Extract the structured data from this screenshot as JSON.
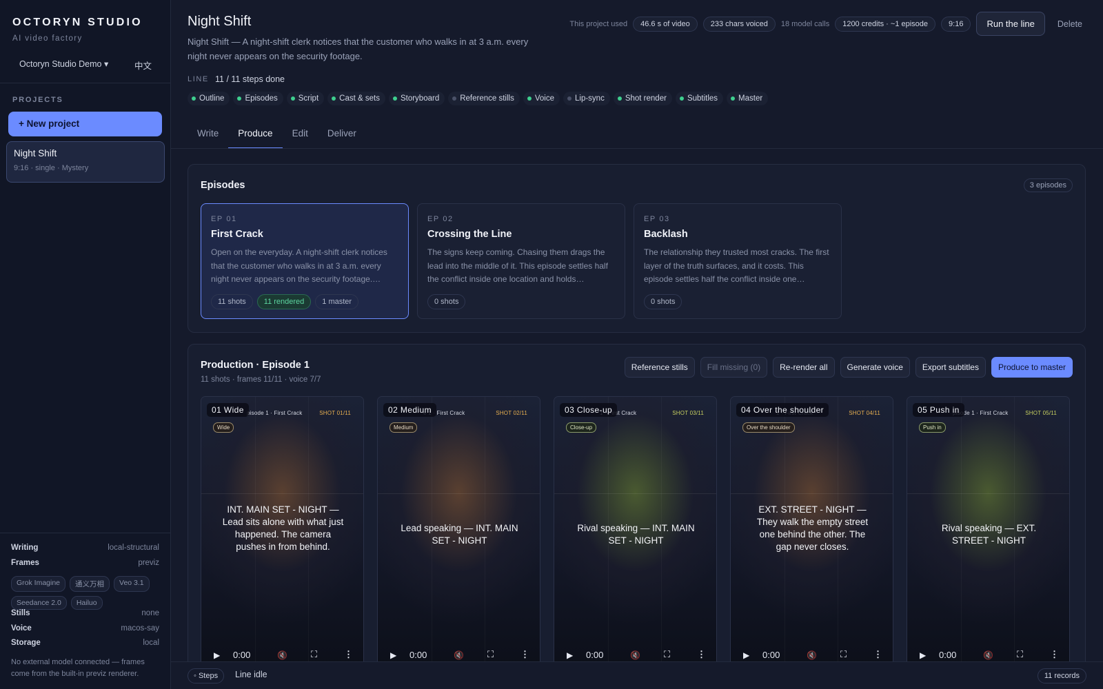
{
  "sidebar": {
    "brand": "OCTORYN STUDIO",
    "brand_sub": "AI video factory",
    "org": "Octoryn Studio Demo ▾",
    "lang": "中文",
    "projects_label": "PROJECTS",
    "new_project": "+ New project",
    "project": {
      "name": "Night Shift",
      "meta": "9:16 · single · Mystery"
    },
    "config": {
      "writing": {
        "label": "Writing",
        "value": "local-structural"
      },
      "frames": {
        "label": "Frames",
        "value": "previz"
      },
      "frame_models": [
        "Grok Imagine",
        "通义万相",
        "Veo 3.1",
        "Seedance 2.0",
        "Hailuo"
      ],
      "stills": {
        "label": "Stills",
        "value": "none"
      },
      "voice": {
        "label": "Voice",
        "value": "macos-say"
      },
      "storage": {
        "label": "Storage",
        "value": "local"
      }
    },
    "note": "No external model connected — frames come from the built-in previz renderer."
  },
  "header": {
    "title": "Night Shift",
    "logline": "Night Shift — A night-shift clerk notices that the customer who walks in at 3 a.m. every night never appears on the security footage.",
    "usage_label": "This project used",
    "video": "46.6 s of video",
    "chars": "233 chars voiced",
    "calls": "18 model calls",
    "credits": "1200 credits · ~1 episode",
    "ratio": "9:16",
    "run": "Run the line",
    "delete": "Delete",
    "line_label": "LINE",
    "line_status": "11 / 11 steps done",
    "steps": [
      {
        "label": "Outline",
        "done": true
      },
      {
        "label": "Episodes",
        "done": true
      },
      {
        "label": "Script",
        "done": true
      },
      {
        "label": "Cast & sets",
        "done": true
      },
      {
        "label": "Storyboard",
        "done": true
      },
      {
        "label": "Reference stills",
        "done": false
      },
      {
        "label": "Voice",
        "done": true
      },
      {
        "label": "Lip-sync",
        "done": false
      },
      {
        "label": "Shot render",
        "done": true
      },
      {
        "label": "Subtitles",
        "done": true
      },
      {
        "label": "Master",
        "done": true
      }
    ],
    "tabs": [
      "Write",
      "Produce",
      "Edit",
      "Deliver"
    ],
    "active_tab": "Produce"
  },
  "colors": {
    "accent": "#6b8bff",
    "done": "#3ecf8e",
    "pending": "#4a5168"
  },
  "episodes": {
    "title": "Episodes",
    "count": "3 episodes",
    "items": [
      {
        "num": "EP 01",
        "title": "First Crack",
        "desc": "Open on the everyday. A night-shift clerk notices that the customer who walks in at 3 a.m. every night never appears on the security footage.…",
        "chips": [
          "11 shots",
          "11 rendered",
          "1 master"
        ]
      },
      {
        "num": "EP 02",
        "title": "Crossing the Line",
        "desc": "The signs keep coming. Chasing them drags the lead into the middle of it. This episode settles half the conflict inside one location and holds…",
        "chips": [
          "0 shots"
        ]
      },
      {
        "num": "EP 03",
        "title": "Backlash",
        "desc": "The relationship they trusted most cracks. The first layer of the truth surfaces, and it costs. This episode settles half the conflict inside one…",
        "chips": [
          "0 shots"
        ]
      }
    ]
  },
  "production": {
    "title": "Production · Episode 1",
    "subtitle": "11 shots · frames 11/11 · voice 7/7",
    "actions": [
      "Reference stills",
      "Fill missing (0)",
      "Re-render all",
      "Generate voice",
      "Export subtitles",
      "Produce to master"
    ],
    "shots": [
      {
        "badge": "01 Wide",
        "caption": "pisode 1 · First Crack",
        "code": "SHOT 01/11",
        "type": "Wide",
        "text": "INT. MAIN SET - NIGHT — Lead sits alone with what just happened. The camera pushes in from behind.",
        "time": "0:00",
        "tint": "#5a4030",
        "codecolor": "#e8b050"
      },
      {
        "badge": "02 Medium",
        "caption": "e 1 · First Crack",
        "code": "SHOT 02/11",
        "type": "Medium",
        "text": "Lead speaking — INT. MAIN SET - NIGHT",
        "time": "0:00",
        "tint": "#5a4030",
        "codecolor": "#e8b050"
      },
      {
        "badge": "03 Close-up",
        "caption": "1 · First Crack",
        "code": "SHOT 03/11",
        "type": "Close-up",
        "text": "Rival speaking — INT. MAIN SET - NIGHT",
        "time": "0:00",
        "tint": "#4a5a30",
        "codecolor": "#c8d060"
      },
      {
        "badge": "04 Over the shoulder",
        "caption": "1 · First Crack",
        "code": "SHOT 04/11",
        "type": "Over the shoulder",
        "text": "EXT. STREET - NIGHT — They walk the empty street one behind the other. The gap never closes.",
        "time": "0:00",
        "tint": "#5a4030",
        "codecolor": "#e8b050"
      },
      {
        "badge": "05 Push in",
        "caption": "pisode 1 · First Crack",
        "code": "SHOT 05/11",
        "type": "Push in",
        "text": "Rival speaking — EXT. STREET - NIGHT",
        "time": "0:00",
        "tint": "#4a5a30",
        "codecolor": "#c8d060"
      }
    ]
  },
  "footer": {
    "steps_chip": "◦ Steps",
    "status": "Line idle",
    "records": "11 records"
  }
}
